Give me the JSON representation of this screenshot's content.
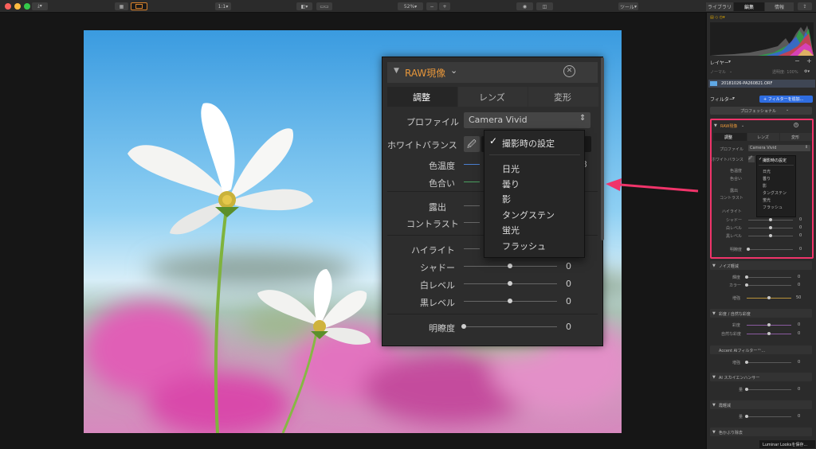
{
  "toolbar": {
    "zoom": "52%",
    "minus": "−",
    "plus": "+",
    "tools": "ツール",
    "tabs": [
      "ライブラリ",
      "編集",
      "情報"
    ]
  },
  "sidebar": {
    "layers_title": "レイヤー",
    "normal_mode": "ノーマル",
    "opacity_label": "透明度: 100%",
    "filename": "20181026-PA260821.ORF",
    "filters_title": "フィルター",
    "add_filter": "+ フィルターを追加...",
    "professional": "プロフェッショナル",
    "raw_title": "RAW現像",
    "raw_tabs": [
      "調整",
      "レンズ",
      "変形"
    ],
    "profile_label": "プロファイル",
    "profile_value": "Camera Vivid",
    "wb_label": "ホワイトバランス",
    "wb_options": [
      "撮影時の設定",
      "日光",
      "曇り",
      "影",
      "タングステン",
      "蛍光",
      "フラッシュ"
    ],
    "left_labels": [
      "色温度",
      "色合い",
      "露出",
      "コントラスト",
      "ハイライト"
    ],
    "sliders": [
      {
        "label": "シャドー",
        "value": "0"
      },
      {
        "label": "白レベル",
        "value": "0"
      },
      {
        "label": "黒レベル",
        "value": "0"
      },
      {
        "label": "明瞭度",
        "value": "0"
      }
    ],
    "noise_title": "ノイズ軽減",
    "noise": [
      {
        "label": "輝度",
        "value": "0"
      },
      {
        "label": "カラー",
        "value": "0"
      },
      {
        "label": "増強",
        "value": "50"
      }
    ],
    "vibrance_title": "彩度 / 自然な彩度",
    "vibrance": [
      {
        "label": "彩度",
        "value": "0"
      },
      {
        "label": "自然な彩度",
        "value": "0"
      }
    ],
    "accent_title": "Accent AIフィルター™...",
    "accent": [
      {
        "label": "増強",
        "value": "0"
      }
    ],
    "sky_title": "AI スカイエンハンサー",
    "sky": [
      {
        "label": "量",
        "value": "0"
      }
    ],
    "haze_title": "霞軽減",
    "haze": [
      {
        "label": "量",
        "value": "0"
      }
    ],
    "color_cast_title": "色かぶり除去",
    "save_looks": "Luminar Looksを保存..."
  },
  "popup": {
    "title": "RAW現像",
    "tabs": [
      "調整",
      "レンズ",
      "変形"
    ],
    "profile_label": "プロファイル",
    "profile_value": "Camera Vivid",
    "wb_label": "ホワイトバランス",
    "wb_checked": "撮影時の設定",
    "wb_options": [
      "日光",
      "曇り",
      "影",
      "タングステン",
      "蛍光",
      "フラッシュ"
    ],
    "left_labels": [
      "色温度",
      "色合い",
      "露出",
      "コントラスト",
      "ハイライト"
    ],
    "temp_partial_value": "3",
    "sliders": [
      {
        "label": "シャドー",
        "value": "0"
      },
      {
        "label": "白レベル",
        "value": "0"
      },
      {
        "label": "黒レベル",
        "value": "0"
      },
      {
        "label": "明瞭度",
        "value": "0"
      }
    ]
  },
  "colors": {
    "accent_orange": "#e8973a",
    "highlight_pink": "#f0346a",
    "add_filter_blue": "#2f6de1"
  }
}
